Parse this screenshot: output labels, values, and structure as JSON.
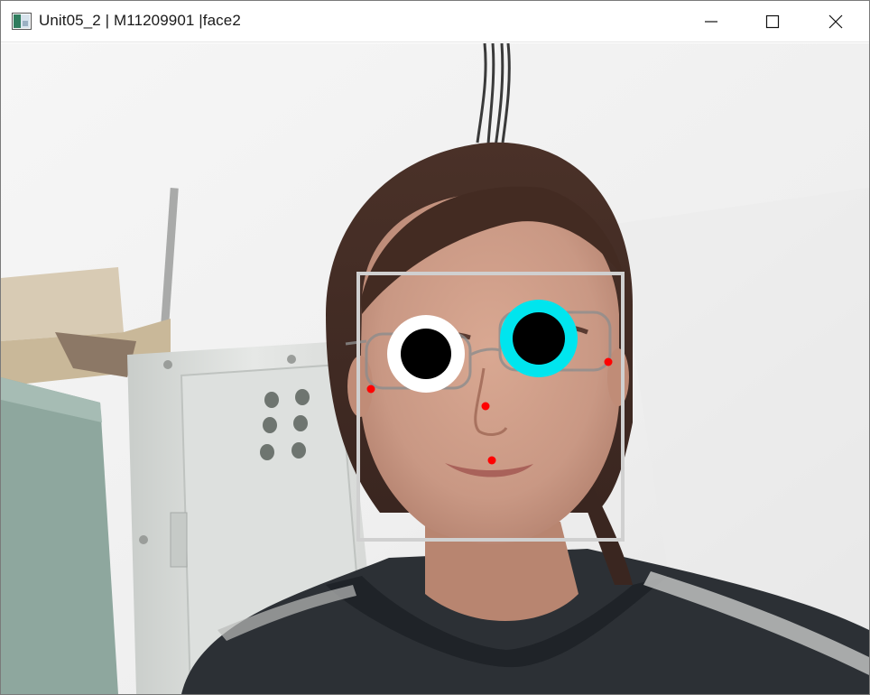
{
  "window": {
    "title": "Unit05_2 | M11209901 |face2",
    "icon": "opencv-window-icon",
    "controls": [
      "minimize-icon",
      "maximize-icon",
      "close-icon"
    ]
  },
  "overlay": {
    "face_box_color": "#d0d0d0",
    "left_eye_ring_color": "#ffffff",
    "right_eye_ring_color": "#00e5ee",
    "pupil_color": "#000000",
    "landmark_color": "#ff0000"
  }
}
